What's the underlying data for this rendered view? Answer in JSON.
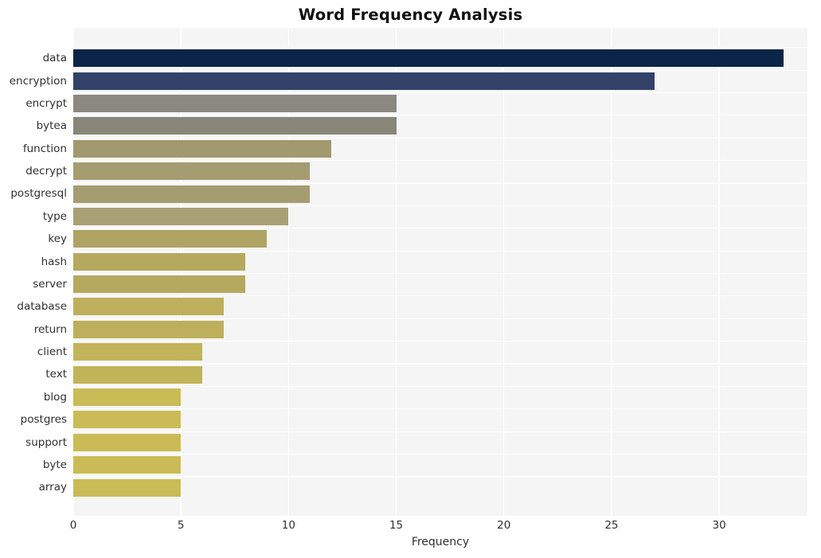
{
  "chart_data": {
    "type": "bar",
    "orientation": "horizontal",
    "title": "Word Frequency Analysis",
    "xlabel": "Frequency",
    "ylabel": "",
    "xlim": [
      0,
      34.1
    ],
    "xticks": [
      0,
      5,
      10,
      15,
      20,
      25,
      30
    ],
    "xticklabels": [
      "0",
      "5",
      "10",
      "15",
      "20",
      "25",
      "30"
    ],
    "grid": "vertical-only",
    "legend": "none",
    "plot_background": "#f5f5f5",
    "gridline_color": "#ffffff",
    "figure_background": "#ffffff",
    "categories": [
      "data",
      "encryption",
      "encrypt",
      "bytea",
      "function",
      "decrypt",
      "postgresql",
      "type",
      "key",
      "hash",
      "server",
      "database",
      "return",
      "client",
      "text",
      "blog",
      "postgres",
      "support",
      "byte",
      "array"
    ],
    "values": [
      33,
      27,
      15,
      15,
      12,
      11,
      11,
      10,
      9,
      8,
      8,
      7,
      7,
      6,
      6,
      5,
      5,
      5,
      5,
      5
    ],
    "bar_colors": [
      "#0a2547",
      "#334268",
      "#8a887f",
      "#878679",
      "#a3996f",
      "#a69c72",
      "#a69c72",
      "#a99f74",
      "#aea363",
      "#b5a85f",
      "#b5a85f",
      "#bdaf5c",
      "#bdaf5c",
      "#c2b459",
      "#c2b459",
      "#cbbb56",
      "#cbbb56",
      "#cbbb56",
      "#cbbb56",
      "#cbbb56"
    ]
  }
}
